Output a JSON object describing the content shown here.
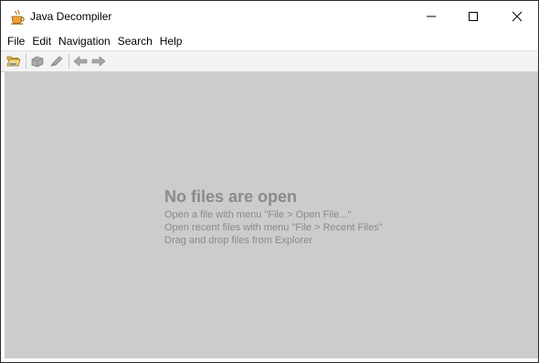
{
  "window": {
    "title": "Java Decompiler"
  },
  "menubar": {
    "items": [
      "File",
      "Edit",
      "Navigation",
      "Search",
      "Help"
    ]
  },
  "toolbar": {
    "buttons": [
      "open-folder-icon",
      "open-type-icon",
      "search-tool-icon",
      "back-arrow-icon",
      "forward-arrow-icon"
    ]
  },
  "empty_state": {
    "title": "No files are open",
    "hints": [
      "Open a file with menu \"File > Open File...\"",
      "Open recent files with menu \"File > Recent Files\"",
      "Drag and drop files from Explorer"
    ]
  },
  "colors": {
    "content_bg": "#cccccc",
    "hint_text": "#8a8a8a",
    "toolbar_bg": "#f3f3f3"
  }
}
